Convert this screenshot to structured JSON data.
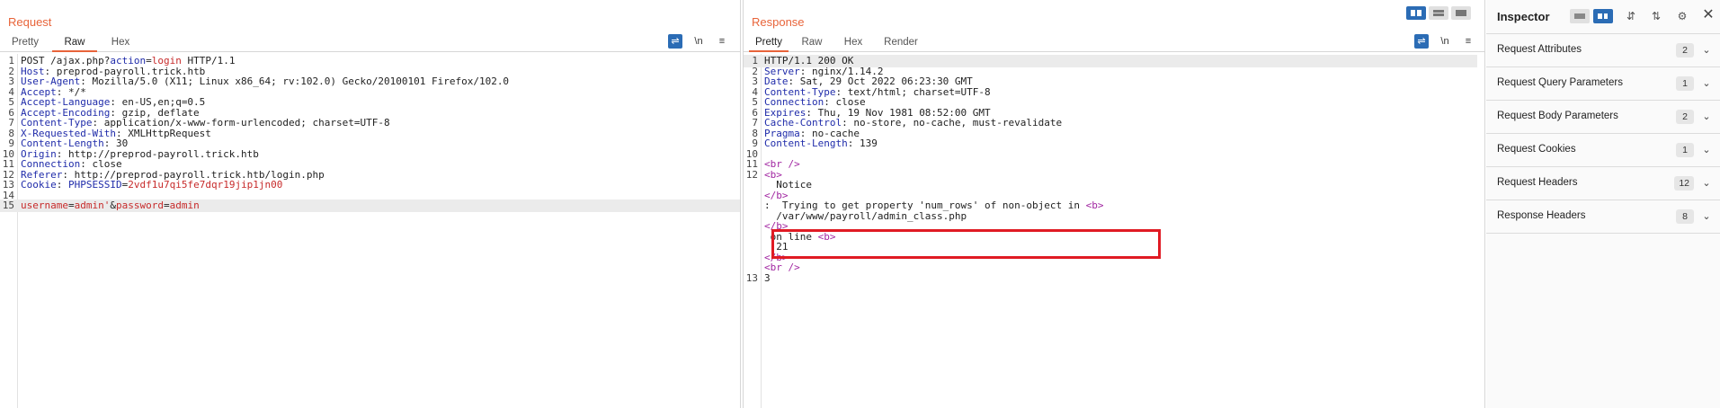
{
  "request": {
    "title": "Request",
    "tabs": [
      "Pretty",
      "Raw",
      "Hex"
    ],
    "active_tab": 1,
    "toolbar": {
      "wrap_icon": "wrap-lines-icon",
      "newline_label": "\\n",
      "menu_icon": "hamburger-icon"
    },
    "lines": [
      [
        {
          "t": "POST /ajax.php?"
        },
        {
          "t": "action",
          "c": "k"
        },
        {
          "t": "="
        },
        {
          "t": "login",
          "c": "v"
        },
        {
          "t": " HTTP/1.1"
        }
      ],
      [
        {
          "t": "Host",
          "c": "k"
        },
        {
          "t": ": preprod-payroll.trick.htb"
        }
      ],
      [
        {
          "t": "User-Agent",
          "c": "k"
        },
        {
          "t": ": Mozilla/5.0 (X11; Linux x86_64; rv:102.0) Gecko/20100101 Firefox/102.0"
        }
      ],
      [
        {
          "t": "Accept",
          "c": "k"
        },
        {
          "t": ": */*"
        }
      ],
      [
        {
          "t": "Accept-Language",
          "c": "k"
        },
        {
          "t": ": en-US,en;q=0.5"
        }
      ],
      [
        {
          "t": "Accept-Encoding",
          "c": "k"
        },
        {
          "t": ": gzip, deflate"
        }
      ],
      [
        {
          "t": "Content-Type",
          "c": "k"
        },
        {
          "t": ": application/x-www-form-urlencoded; charset=UTF-8"
        }
      ],
      [
        {
          "t": "X-Requested-With",
          "c": "k"
        },
        {
          "t": ": XMLHttpRequest"
        }
      ],
      [
        {
          "t": "Content-Length",
          "c": "k"
        },
        {
          "t": ": 30"
        }
      ],
      [
        {
          "t": "Origin",
          "c": "k"
        },
        {
          "t": ": http://preprod-payroll.trick.htb"
        }
      ],
      [
        {
          "t": "Connection",
          "c": "k"
        },
        {
          "t": ": close"
        }
      ],
      [
        {
          "t": "Referer",
          "c": "k"
        },
        {
          "t": ": http://preprod-payroll.trick.htb/login.php"
        }
      ],
      [
        {
          "t": "Cookie",
          "c": "k"
        },
        {
          "t": ": "
        },
        {
          "t": "PHPSESSID",
          "c": "k"
        },
        {
          "t": "="
        },
        {
          "t": "2vdf1u7qi5fe7dqr19jip1jn00",
          "c": "v"
        }
      ],
      [],
      [
        {
          "t": "username",
          "c": "v"
        },
        {
          "t": "="
        },
        {
          "t": "admin'",
          "c": "v"
        },
        {
          "t": "&"
        },
        {
          "t": "password",
          "c": "v"
        },
        {
          "t": "="
        },
        {
          "t": "admin",
          "c": "v"
        }
      ]
    ],
    "highlighted_line": 15
  },
  "response": {
    "title": "Response",
    "tabs": [
      "Pretty",
      "Raw",
      "Hex",
      "Render"
    ],
    "active_tab": 0,
    "toolbar": {
      "wrap_icon": "wrap-lines-icon",
      "newline_label": "\\n",
      "menu_icon": "hamburger-icon"
    },
    "lines": [
      {
        "n": "1",
        "s": [
          {
            "t": "HTTP/1.1 200 OK"
          }
        ]
      },
      {
        "n": "2",
        "s": [
          {
            "t": "Server",
            "c": "k"
          },
          {
            "t": ": nginx/1.14.2"
          }
        ]
      },
      {
        "n": "3",
        "s": [
          {
            "t": "Date",
            "c": "k"
          },
          {
            "t": ": Sat, 29 Oct 2022 06:23:30 GMT"
          }
        ]
      },
      {
        "n": "4",
        "s": [
          {
            "t": "Content-Type",
            "c": "k"
          },
          {
            "t": ": text/html; charset=UTF-8"
          }
        ]
      },
      {
        "n": "5",
        "s": [
          {
            "t": "Connection",
            "c": "k"
          },
          {
            "t": ": close"
          }
        ]
      },
      {
        "n": "6",
        "s": [
          {
            "t": "Expires",
            "c": "k"
          },
          {
            "t": ": Thu, 19 Nov 1981 08:52:00 GMT"
          }
        ]
      },
      {
        "n": "7",
        "s": [
          {
            "t": "Cache-Control",
            "c": "k"
          },
          {
            "t": ": no-store, no-cache, must-revalidate"
          }
        ]
      },
      {
        "n": "8",
        "s": [
          {
            "t": "Pragma",
            "c": "k"
          },
          {
            "t": ": no-cache"
          }
        ]
      },
      {
        "n": "9",
        "s": [
          {
            "t": "Content-Length",
            "c": "k"
          },
          {
            "t": ": 139"
          }
        ]
      },
      {
        "n": "10",
        "s": []
      },
      {
        "n": "11",
        "s": [
          {
            "t": "<br />",
            "c": "t"
          }
        ]
      },
      {
        "n": "12",
        "s": [
          {
            "t": "<b>",
            "c": "t"
          }
        ]
      },
      {
        "n": "",
        "s": [
          {
            "t": "  Notice"
          }
        ]
      },
      {
        "n": "",
        "s": [
          {
            "t": "</b>",
            "c": "t"
          }
        ]
      },
      {
        "n": "",
        "s": [
          {
            "t": ":  Trying to get property 'num_rows' of non-object in "
          },
          {
            "t": "<b>",
            "c": "t"
          }
        ]
      },
      {
        "n": "",
        "s": [
          {
            "t": "  /var/www/payroll/admin_class.php"
          }
        ]
      },
      {
        "n": "",
        "s": [
          {
            "t": "</b>",
            "c": "t"
          }
        ]
      },
      {
        "n": "",
        "s": [
          {
            "t": " on line "
          },
          {
            "t": "<b>",
            "c": "t"
          }
        ]
      },
      {
        "n": "",
        "s": [
          {
            "t": "  21"
          }
        ]
      },
      {
        "n": "",
        "s": [
          {
            "t": "</b>",
            "c": "t"
          }
        ]
      },
      {
        "n": "",
        "s": [
          {
            "t": "<br />",
            "c": "t"
          }
        ]
      },
      {
        "n": "13",
        "s": [
          {
            "t": "3"
          }
        ]
      }
    ],
    "highlighted_line": 1
  },
  "view_toggles": [
    "split-vertical-icon",
    "split-horizontal-icon",
    "single-pane-icon"
  ],
  "inspector": {
    "title": "Inspector",
    "tools": [
      "layout-horizontal-icon",
      "layout-vertical-icon",
      "expand-all-icon",
      "collapse-all-icon",
      "gear-icon",
      "close-icon"
    ],
    "close_glyph": "✕",
    "items": [
      {
        "label": "Request Attributes",
        "count": "2"
      },
      {
        "label": "Request Query Parameters",
        "count": "1"
      },
      {
        "label": "Request Body Parameters",
        "count": "2"
      },
      {
        "label": "Request Cookies",
        "count": "1"
      },
      {
        "label": "Request Headers",
        "count": "12"
      },
      {
        "label": "Response Headers",
        "count": "8"
      }
    ]
  }
}
